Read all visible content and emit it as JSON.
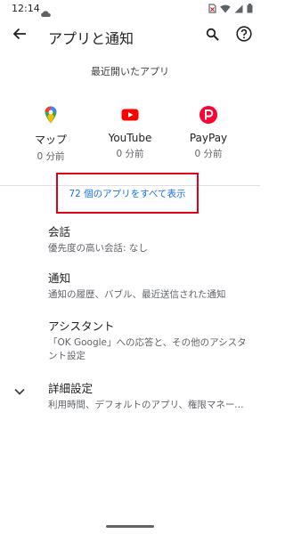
{
  "status_bar": {
    "time": "12:14"
  },
  "app_bar": {
    "title": "アプリと通知",
    "back_icon": "arrow-back-icon",
    "search_icon": "search-icon",
    "help_icon": "help-icon"
  },
  "recent": {
    "header": "最近開いたアプリ",
    "apps": [
      {
        "name": "マップ",
        "time": "0 分前",
        "icon": "google-maps-icon"
      },
      {
        "name": "YouTube",
        "time": "0 分前",
        "icon": "youtube-icon"
      },
      {
        "name": "PayPay",
        "time": "0 分前",
        "icon": "paypay-icon"
      }
    ],
    "see_all": "72 個のアプリをすべて表示"
  },
  "preferences": [
    {
      "title": "会話",
      "summary": "優先度の高い会話: なし"
    },
    {
      "title": "通知",
      "summary": "通知の履歴、バブル、最近送信された通知"
    },
    {
      "title": "アシスタント",
      "summary": "「OK Google」への応答と、その他のアシスタント設定"
    },
    {
      "title": "詳細設定",
      "summary": "利用時間、デフォルトのアプリ、権限マネージャー、緊急速報メール、特別なアプリアクセス"
    }
  ],
  "colors": {
    "accent": "#1a73e8",
    "highlight_box": "#e1001a",
    "youtube_red": "#ff0000",
    "paypay_red": "#ff0033"
  }
}
